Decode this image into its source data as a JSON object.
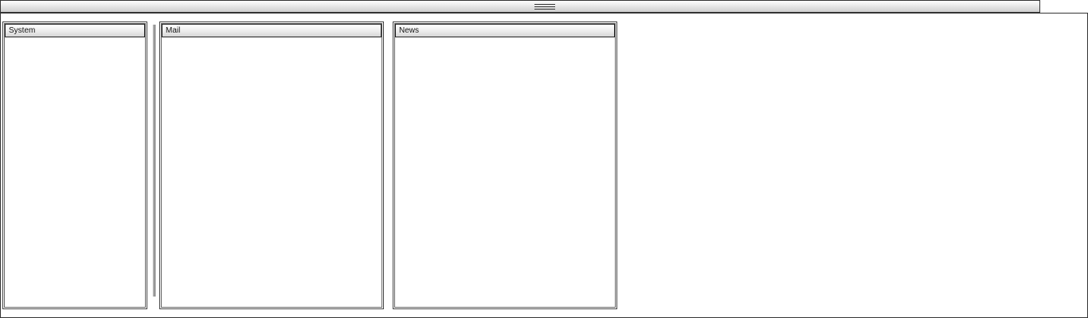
{
  "panels": {
    "system": {
      "title": "System"
    },
    "mail": {
      "title": "Mail"
    },
    "news": {
      "title": "News"
    }
  }
}
